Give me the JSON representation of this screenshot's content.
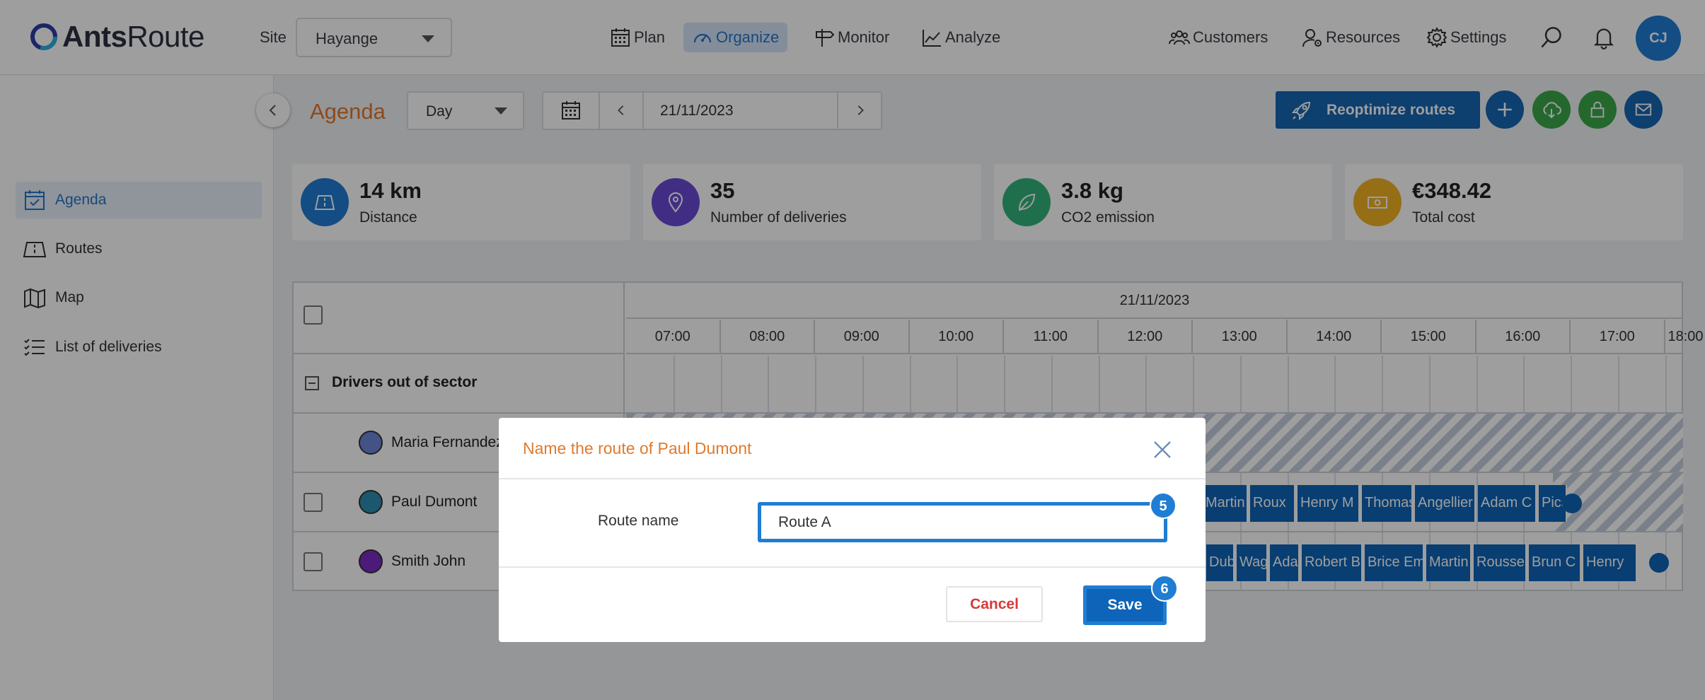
{
  "app": {
    "brand_bold": "Ants",
    "brand_light": "Route"
  },
  "header": {
    "site_label": "Site",
    "site_value": "Hayange",
    "nav": [
      {
        "label": "Plan",
        "icon": "calendar-icon"
      },
      {
        "label": "Organize",
        "icon": "gauge-icon"
      },
      {
        "label": "Monitor",
        "icon": "signpost-icon"
      },
      {
        "label": "Analyze",
        "icon": "chart-icon"
      }
    ],
    "right_nav": [
      {
        "label": "Customers",
        "icon": "users-icon"
      },
      {
        "label": "Resources",
        "icon": "user-gear-icon"
      },
      {
        "label": "Settings",
        "icon": "gear-icon"
      }
    ],
    "avatar_initials": "CJ"
  },
  "sidebar": {
    "items": [
      {
        "label": "Agenda",
        "icon": "calendar-check-icon",
        "active": true
      },
      {
        "label": "Routes",
        "icon": "road-icon"
      },
      {
        "label": "Map",
        "icon": "map-icon"
      },
      {
        "label": "List of deliveries",
        "icon": "list-icon"
      }
    ]
  },
  "toolbar": {
    "title": "Agenda",
    "view": "Day",
    "date": "21/11/2023",
    "reoptimize_label": "Reoptimize routes"
  },
  "stats": [
    {
      "value": "14 km",
      "label": "Distance",
      "color": "#1f7dd3",
      "icon": "road-icon"
    },
    {
      "value": "35",
      "label": "Number of deliveries",
      "color": "#6a4bd6",
      "icon": "pin-icon"
    },
    {
      "value": "3.8 kg",
      "label": "CO2 emission",
      "color": "#34b37b",
      "icon": "leaf-icon"
    },
    {
      "value": "€348.42",
      "label": "Total cost",
      "color": "#f0b224",
      "icon": "money-icon"
    }
  ],
  "grid": {
    "date": "21/11/2023",
    "hours": [
      "07:00",
      "08:00",
      "09:00",
      "10:00",
      "11:00",
      "12:00",
      "13:00",
      "14:00",
      "15:00",
      "16:00",
      "17:00",
      "18:00"
    ],
    "group_label": "Drivers out of sector",
    "drivers": [
      {
        "name": "Maria Fernandez",
        "color": "#6c86d8"
      },
      {
        "name": "Paul Dumont",
        "color": "#2d8fb0"
      },
      {
        "name": "Smith John",
        "color": "#7b2bc4"
      }
    ],
    "paul_tasks": [
      "Martin",
      "Roux",
      "Henry M",
      "Thomas",
      "Angellier",
      "Adam C",
      "Picard"
    ],
    "smith_tasks": [
      "Dubois",
      "Wagner",
      "Adam",
      "Robert B",
      "Brice Em",
      "Martin",
      "Rousseau",
      "Brun C",
      "Henry"
    ]
  },
  "modal": {
    "title": "Name the route of Paul Dumont",
    "field_label": "Route name",
    "field_value": "Route A",
    "cancel_label": "Cancel",
    "save_label": "Save",
    "step_input": "5",
    "step_save": "6"
  }
}
